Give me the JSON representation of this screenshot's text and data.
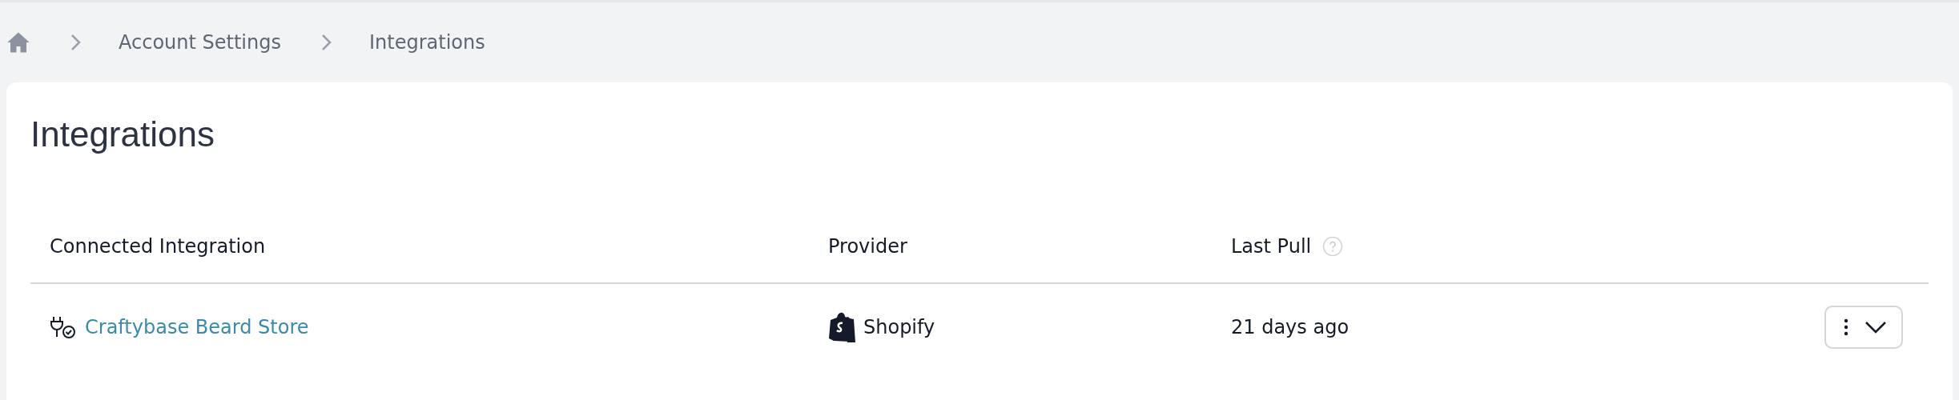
{
  "breadcrumb": [
    {
      "label": "Account Settings"
    },
    {
      "label": "Integrations"
    }
  ],
  "page_title": "Integrations",
  "table": {
    "columns": [
      {
        "label": "Connected Integration"
      },
      {
        "label": "Provider"
      },
      {
        "label": "Last Pull",
        "help": true
      }
    ],
    "rows": [
      {
        "name": "Craftybase Beard Store",
        "provider": "Shopify",
        "last_pull": "21 days ago"
      }
    ]
  }
}
